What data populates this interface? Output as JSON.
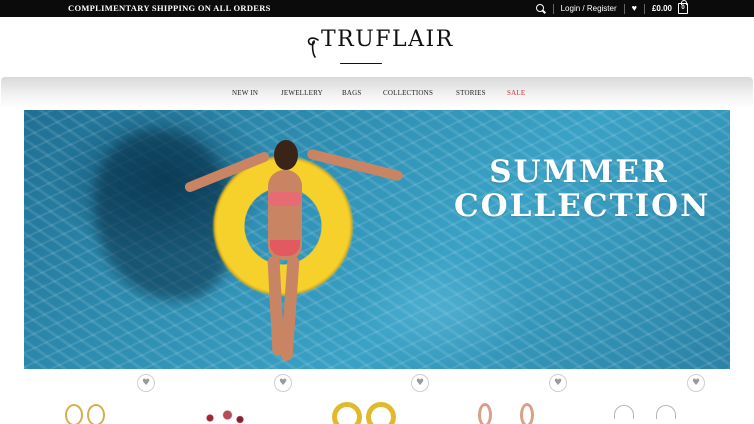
{
  "topbar": {
    "promo": "COMPLIMENTARY SHIPPING ON ALL ORDERS",
    "login": "Login / Register",
    "cart_total": "£0.00",
    "cart_count": "0",
    "icons": {
      "search": "search-icon",
      "wishlist": "heart-icon",
      "cart": "shopping-bag-icon"
    }
  },
  "brand": {
    "name": "TRUFLAIR"
  },
  "nav": {
    "items": [
      {
        "label": "NEW IN"
      },
      {
        "label": "JEWELLERY"
      },
      {
        "label": "BAGS"
      },
      {
        "label": "COLLECTIONS"
      },
      {
        "label": "STORIES"
      },
      {
        "label": "SALE"
      }
    ]
  },
  "hero": {
    "title_line1": "SUMMER",
    "title_line2": "COLLECTION"
  },
  "products": [
    {
      "wishlist_icon": "heart-icon",
      "color": "#d4b04a"
    },
    {
      "wishlist_icon": "heart-icon",
      "color": "#a0263a"
    },
    {
      "wishlist_icon": "heart-icon",
      "color": "#e0b92c"
    },
    {
      "wishlist_icon": "heart-icon",
      "color": "#d9a089"
    },
    {
      "wishlist_icon": "heart-icon",
      "color": "#b5b5b5"
    }
  ],
  "colors": {
    "topbar_bg": "#0b0b0b",
    "sale": "#cc3333",
    "pool_blue": "#2f8fb3",
    "float_yellow": "#f7d12b"
  }
}
